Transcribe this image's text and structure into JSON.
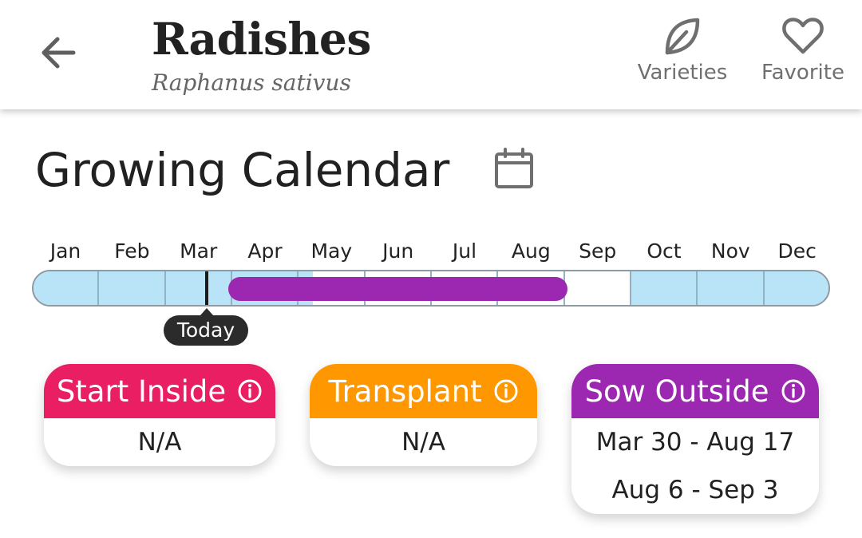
{
  "header": {
    "title": "Radishes",
    "subtitle": "Raphanus sativus",
    "back_icon": "arrow-left-icon",
    "actions": [
      {
        "label": "Varieties",
        "icon": "leaf-icon"
      },
      {
        "label": "Favorite",
        "icon": "heart-outline-icon"
      }
    ]
  },
  "calendar": {
    "title": "Growing Calendar",
    "icon": "calendar-icon",
    "months": [
      "Jan",
      "Feb",
      "Mar",
      "Apr",
      "May",
      "Jun",
      "Jul",
      "Aug",
      "Sep",
      "Oct",
      "Nov",
      "Dec"
    ],
    "today_label": "Today",
    "today_month_position": 2.6,
    "cool_season_ranges": [
      [
        0,
        4.2
      ],
      [
        9,
        12
      ]
    ],
    "sow_outside_bar": [
      2.95,
      8.0
    ],
    "colors": {
      "cool": "#b9e3f7",
      "warm": "#ffffff",
      "sow": "#9c27b0",
      "track_border": "#8e9aa2"
    }
  },
  "cards": {
    "start_inside": {
      "label": "Start Inside",
      "color": "#e91e63",
      "values": [
        "N/A"
      ]
    },
    "transplant": {
      "label": "Transplant",
      "color": "#ff9800",
      "values": [
        "N/A"
      ]
    },
    "sow_outside": {
      "label": "Sow Outside",
      "color": "#9c27b0",
      "values": [
        "Mar 30 - Aug 17",
        "Aug 6 - Sep 3"
      ]
    }
  }
}
